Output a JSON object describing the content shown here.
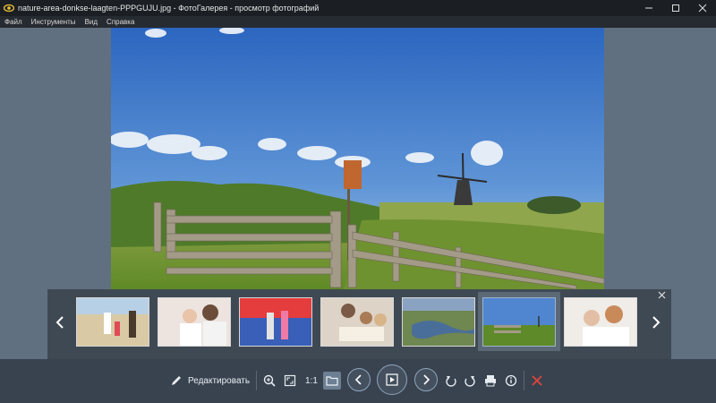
{
  "window": {
    "title": "nature-area-donkse-laagten-PPPGUJU.jpg - ФотоГалерея - просмотр фотографий",
    "controls": [
      "minimize-icon",
      "maximize-icon",
      "close-icon"
    ]
  },
  "menu": {
    "items": [
      "Файл",
      "Инструменты",
      "Вид",
      "Справка"
    ]
  },
  "viewer": {
    "image_description_icon": "photo-windmill-landscape"
  },
  "filmstrip": {
    "prev_icon": "chevron-left-icon",
    "next_icon": "chevron-right-icon",
    "close_icon": "close-icon",
    "selected_index": 5,
    "thumbs": [
      "beach-family",
      "girl-mother",
      "kids-gym",
      "family-reading",
      "wetland-aerial",
      "windmill-landscape",
      "mother-child"
    ]
  },
  "toolbar": {
    "edit_label": "Редактировать",
    "zoom_ratio": "1:1"
  },
  "colors": {
    "titlebar": "#1b1f24",
    "stage": "#607080",
    "strip": "#3f4954",
    "toolbar": "#394350",
    "delete": "#e0453a"
  }
}
